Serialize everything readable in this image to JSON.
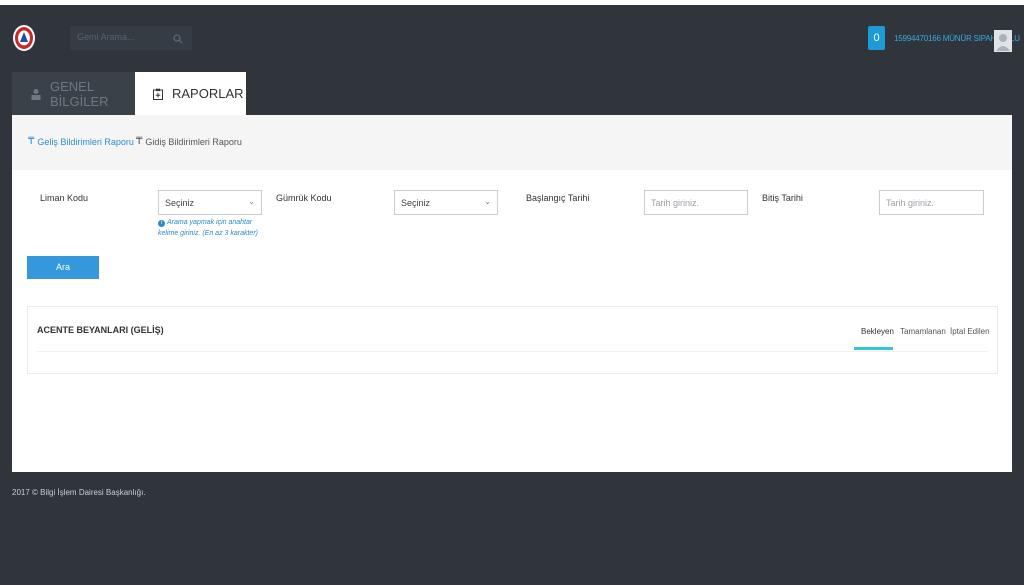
{
  "header": {
    "search_placeholder": "Gemi Arama...",
    "notification_count": "0",
    "user_name": "15994470166 MÜNÜR SIPAHIOĞLU"
  },
  "tabs": [
    {
      "label": "GENEL BİLGİLER",
      "icon": "user-icon",
      "active": false
    },
    {
      "label": "RAPORLAR",
      "icon": "report-icon",
      "active": true
    }
  ],
  "subnav": [
    {
      "label": "Geliş Bildirimleri Raporu",
      "icon": "pin-icon",
      "active": true
    },
    {
      "label": "Gidiş Bildirimleri Raporu",
      "icon": "pin-icon",
      "active": false
    }
  ],
  "form": {
    "liman_label": "Liman Kodu",
    "liman_value": "Seçiniz",
    "gumruk_label": "Gümrük Kodu",
    "gumruk_value": "Seçiniz",
    "baslangic_label": "Başlangıç Tarihi",
    "baslangic_placeholder": "Tarih giriniz.",
    "bitis_label": "Bitiş Tarihi",
    "bitis_placeholder": "Tarih giriniz.",
    "hint": "Arama yapmak için anahtar kelime giriniz. (En az 3 karakter)",
    "search_button": "Ara"
  },
  "card": {
    "title": "ACENTE BEYANLARI (GELİŞ)",
    "tabs": [
      "Bekleyen",
      "Tamamlanan",
      "İptal Edilen"
    ],
    "active_tab": "Bekleyen"
  },
  "footer": {
    "text": "2017 © Bilgi İşlem Dairesi Başkanlığı."
  },
  "colors": {
    "background": "#2f353b",
    "accent": "#3598dc",
    "active_tab_underline": "#36c6d3"
  }
}
